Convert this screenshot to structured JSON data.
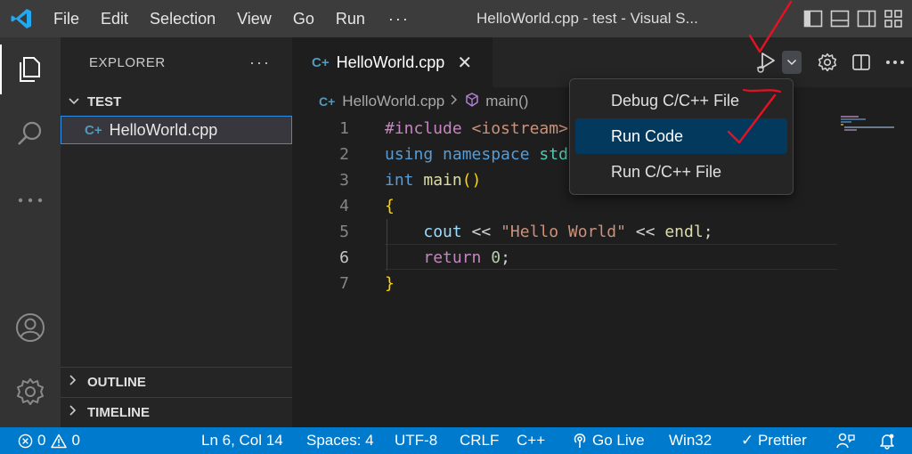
{
  "titlebar": {
    "menu": [
      "File",
      "Edit",
      "Selection",
      "View",
      "Go",
      "Run"
    ],
    "more": "···",
    "title": "HelloWorld.cpp - test - Visual S..."
  },
  "sidebar": {
    "title": "EXPLORER",
    "more": "···",
    "folder": "TEST",
    "file": "HelloWorld.cpp",
    "outline": "OUTLINE",
    "timeline": "TIMELINE"
  },
  "editor": {
    "tab_label": "HelloWorld.cpp",
    "tab_close": "✕",
    "breadcrumb_file": "HelloWorld.cpp",
    "breadcrumb_symbol": "main()",
    "lines": [
      {
        "n": "1",
        "parts": [
          [
            "kw-purple",
            "#include "
          ],
          [
            "str",
            "<iostream>"
          ]
        ]
      },
      {
        "n": "2",
        "parts": [
          [
            "kw-blue",
            "using "
          ],
          [
            "kw-blue",
            "namespace "
          ],
          [
            "ty-teal",
            "std"
          ],
          [
            "plain",
            ";"
          ]
        ]
      },
      {
        "n": "3",
        "parts": [
          [
            "kw-blue",
            "int "
          ],
          [
            "fn",
            "main"
          ],
          [
            "brace",
            "()"
          ]
        ]
      },
      {
        "n": "4",
        "parts": [
          [
            "brace",
            "{"
          ]
        ]
      },
      {
        "n": "5",
        "parts": [
          [
            "plain",
            "    "
          ],
          [
            "var",
            "cout"
          ],
          [
            "plain",
            " << "
          ],
          [
            "str",
            "\"Hello World\""
          ],
          [
            "plain",
            " << "
          ],
          [
            "fn",
            "endl"
          ],
          [
            "plain",
            ";"
          ]
        ]
      },
      {
        "n": "6",
        "parts": [
          [
            "plain",
            "    "
          ],
          [
            "kw-purple",
            "return "
          ],
          [
            "num",
            "0"
          ],
          [
            "plain",
            ";"
          ]
        ]
      },
      {
        "n": "7",
        "parts": [
          [
            "brace",
            "}"
          ]
        ]
      }
    ],
    "active_line": "6"
  },
  "run_menu": {
    "items": [
      "Debug C/C++ File",
      "Run Code",
      "Run C/C++ File"
    ],
    "selected": 1
  },
  "statusbar": {
    "errors": "0",
    "warnings": "0",
    "position": "Ln 6, Col 14",
    "spaces": "Spaces: 4",
    "encoding": "UTF-8",
    "eol": "CRLF",
    "language": "C++",
    "golive": "Go Live",
    "platform": "Win32",
    "prettier": "✓ Prettier"
  },
  "colors": {
    "accent": "#007acc",
    "selected_menu": "#04395e",
    "annotation": "#e81123"
  }
}
